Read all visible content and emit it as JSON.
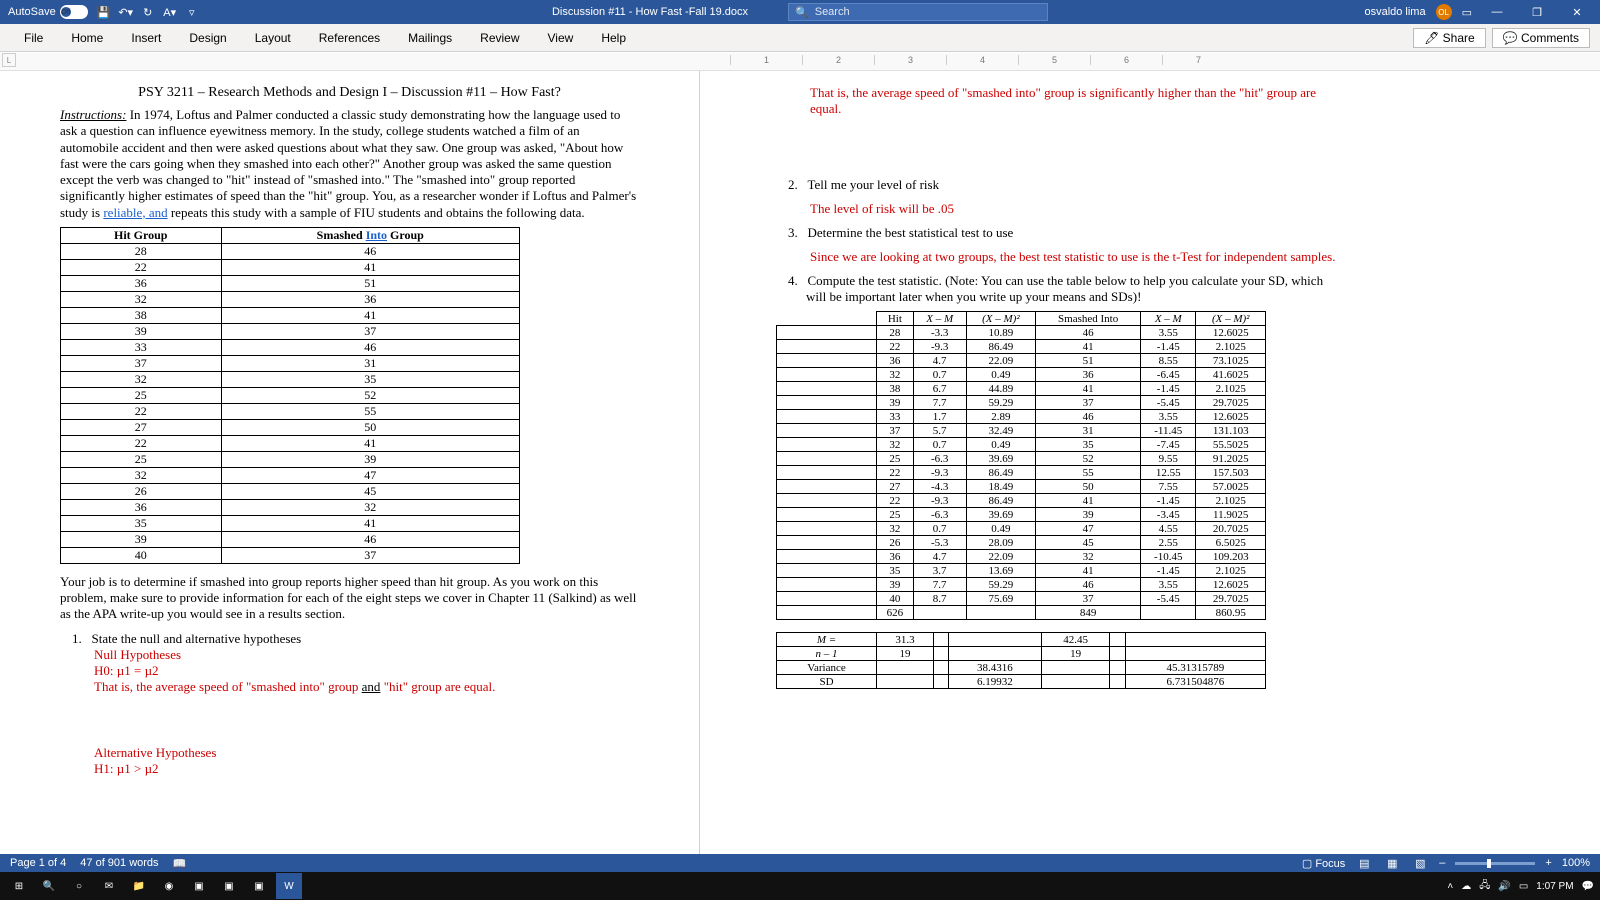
{
  "titlebar": {
    "autosave_label": "AutoSave",
    "autosave_state": "Off",
    "doc_title": "Discussion #11 - How Fast -Fall 19.docx",
    "search_label": "Search",
    "user_name": "osvaldo lima",
    "user_initials": "OL"
  },
  "ribbon": {
    "tabs": [
      "File",
      "Home",
      "Insert",
      "Design",
      "Layout",
      "References",
      "Mailings",
      "Review",
      "View",
      "Help"
    ],
    "share": "Share",
    "comments": "Comments"
  },
  "ruler_marks": [
    "1",
    "2",
    "3",
    "4",
    "5",
    "6",
    "7"
  ],
  "page_left": {
    "title": "PSY 3211 – Research Methods and Design I – Discussion #11 – How Fast?",
    "instructions_label": "Instructions:",
    "instructions_body": " In 1974, Loftus and Palmer conducted a classic study demonstrating how the language used to ask a question can influence eyewitness memory. In the study, college students watched a film of an automobile accident and then were asked questions about what they saw. One group was asked, \"About how fast were the cars going when they smashed into each other?\" Another group was asked the same question except the verb was changed to \"hit\" instead of \"smashed into.\" The \"smashed into\" group reported significantly higher estimates of speed than the \"hit\" group. You, as a researcher wonder if Loftus and Palmer's study is ",
    "instructions_reliable": "reliable, and",
    "instructions_tail": " repeats this study with a sample of FIU students and obtains the following data.",
    "table_head_hit": "Hit Group",
    "table_head_smashed_pre": "Smashed ",
    "table_head_smashed_into": "Into",
    "table_head_smashed_post": " Group",
    "data": [
      [
        28,
        46
      ],
      [
        22,
        41
      ],
      [
        36,
        51
      ],
      [
        32,
        36
      ],
      [
        38,
        41
      ],
      [
        39,
        37
      ],
      [
        33,
        46
      ],
      [
        37,
        31
      ],
      [
        32,
        35
      ],
      [
        25,
        52
      ],
      [
        22,
        55
      ],
      [
        27,
        50
      ],
      [
        22,
        41
      ],
      [
        25,
        39
      ],
      [
        32,
        47
      ],
      [
        26,
        45
      ],
      [
        36,
        32
      ],
      [
        35,
        41
      ],
      [
        39,
        46
      ],
      [
        40,
        37
      ]
    ],
    "job_text": "Your job is to determine if smashed into group reports higher speed than hit group. As you work on this problem, make sure to provide information for each of the eight steps we cover in Chapter 11 (Salkind) as well as the APA write-up you would see in a results section.",
    "q1": "State the null and alternative hypotheses",
    "null_h": "Null Hypotheses",
    "h0": "H0: µ1 = µ2",
    "h0_exp_a": "That is, the average speed of \"smashed into\" group ",
    "h0_exp_and": "and",
    "h0_exp_b": "  \"hit\" group  are equal.",
    "alt_h": "Alternative Hypotheses",
    "h1": "H1: µ1 > µ2"
  },
  "page_right": {
    "h1_expl": "That is, the average speed of \"smashed into\" group is significantly higher than the \"hit\" group are equal.",
    "q2": "Tell me your level of risk",
    "a2": "The level of risk will be .05",
    "q3": "Determine the best statistical test to use",
    "a3": "Since we are looking at two groups, the best test statistic to use is the t-Test for independent samples.",
    "q4": "Compute the test statistic. (Note: You can use the table below to help you calculate your SD, which will be important later when you write up your means and SDs)!",
    "stats_header": [
      "Hit",
      "X – M",
      "(X – M)²",
      "Smashed Into",
      "X – M",
      "(X – M)²"
    ],
    "stats": [
      [
        28,
        -3.3,
        10.89,
        46,
        3.55,
        12.6025
      ],
      [
        22,
        -9.3,
        86.49,
        41,
        -1.45,
        2.1025
      ],
      [
        36,
        4.7,
        22.09,
        51,
        8.55,
        73.1025
      ],
      [
        32,
        0.7,
        0.49,
        36,
        -6.45,
        41.6025
      ],
      [
        38,
        6.7,
        44.89,
        41,
        -1.45,
        2.1025
      ],
      [
        39,
        7.7,
        59.29,
        37,
        -5.45,
        29.7025
      ],
      [
        33,
        1.7,
        2.89,
        46,
        3.55,
        12.6025
      ],
      [
        37,
        5.7,
        32.49,
        31,
        -11.45,
        131.103
      ],
      [
        32,
        0.7,
        0.49,
        35,
        -7.45,
        55.5025
      ],
      [
        25,
        -6.3,
        39.69,
        52,
        9.55,
        91.2025
      ],
      [
        22,
        -9.3,
        86.49,
        55,
        12.55,
        157.503
      ],
      [
        27,
        -4.3,
        18.49,
        50,
        7.55,
        57.0025
      ],
      [
        22,
        -9.3,
        86.49,
        41,
        -1.45,
        2.1025
      ],
      [
        25,
        -6.3,
        39.69,
        39,
        -3.45,
        11.9025
      ],
      [
        32,
        0.7,
        0.49,
        47,
        4.55,
        20.7025
      ],
      [
        26,
        -5.3,
        28.09,
        45,
        2.55,
        6.5025
      ],
      [
        36,
        4.7,
        22.09,
        32,
        -10.45,
        109.203
      ],
      [
        35,
        3.7,
        13.69,
        41,
        -1.45,
        2.1025
      ],
      [
        39,
        7.7,
        59.29,
        46,
        3.55,
        12.6025
      ],
      [
        40,
        8.7,
        75.69,
        37,
        -5.45,
        29.7025
      ]
    ],
    "totals": [
      626,
      "",
      "",
      849,
      "",
      860.95
    ],
    "summary": [
      [
        "M =",
        "31.3",
        "",
        "",
        "42.45",
        "",
        ""
      ],
      [
        "n – 1",
        "19",
        "",
        "",
        "19",
        "",
        ""
      ],
      [
        "Variance",
        "",
        "",
        "38.4316",
        "",
        "",
        "45.31315789"
      ],
      [
        "SD",
        "",
        "",
        "6.19932",
        "",
        "",
        "6.731504876"
      ]
    ]
  },
  "statusbar": {
    "page": "Page 1 of 4",
    "words": "47 of 901 words",
    "focus": "Focus",
    "zoom": "100%"
  },
  "taskbar": {
    "time": "1:07 PM"
  }
}
